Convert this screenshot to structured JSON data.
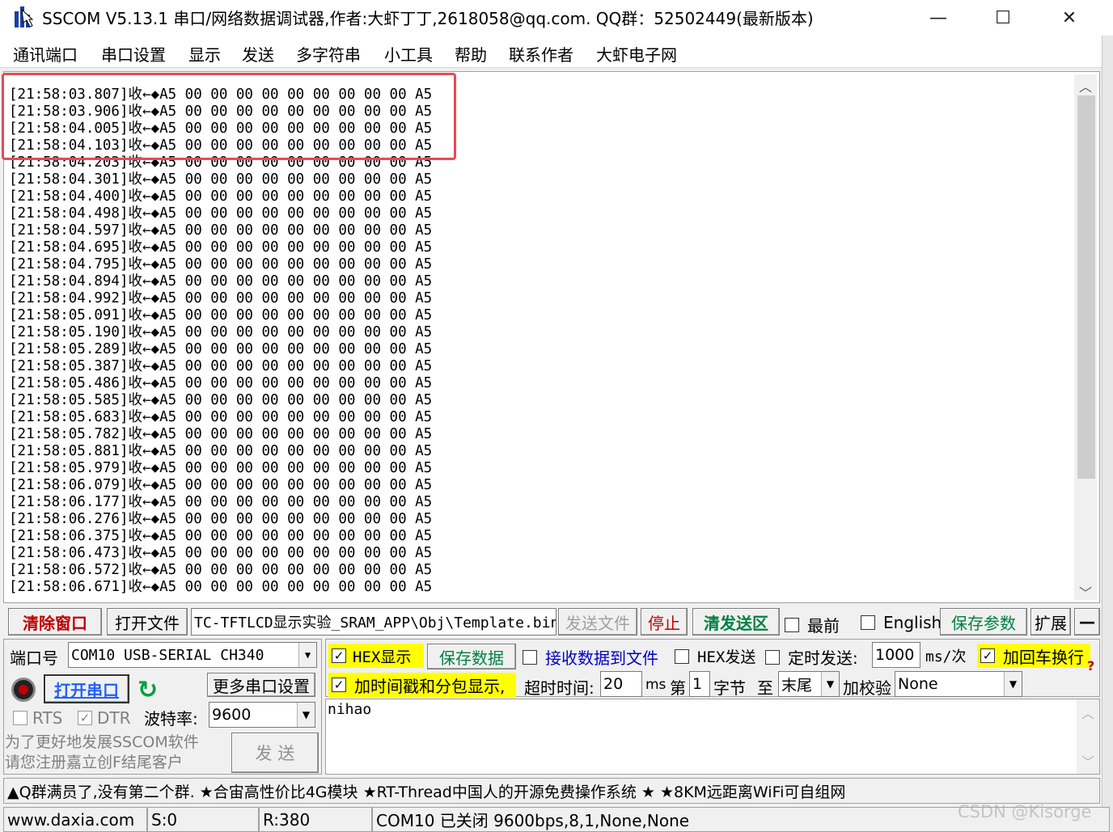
{
  "window": {
    "title": "SSCOM V5.13.1 串口/网络数据调试器,作者:大虾丁丁,2618058@qq.com. QQ群：52502449(最新版本)",
    "minimize": "—",
    "maximize": "☐",
    "close": "✕"
  },
  "menu": [
    "通讯端口",
    "串口设置",
    "显示",
    "发送",
    "多字符串",
    "小工具",
    "帮助",
    "联系作者",
    "大虾电子网"
  ],
  "log": {
    "direction": "收←◆",
    "payload": "A5 00 00 00 00 00 00 00 00 00 A5",
    "timestamps": [
      "21:58:03.807",
      "21:58:03.906",
      "21:58:04.005",
      "21:58:04.103",
      "21:58:04.203",
      "21:58:04.301",
      "21:58:04.400",
      "21:58:04.498",
      "21:58:04.597",
      "21:58:04.695",
      "21:58:04.795",
      "21:58:04.894",
      "21:58:04.992",
      "21:58:05.091",
      "21:58:05.190",
      "21:58:05.289",
      "21:58:05.387",
      "21:58:05.486",
      "21:58:05.585",
      "21:58:05.683",
      "21:58:05.782",
      "21:58:05.881",
      "21:58:05.979",
      "21:58:06.079",
      "21:58:06.177",
      "21:58:06.276",
      "21:58:06.375",
      "21:58:06.473",
      "21:58:06.572",
      "21:58:06.671"
    ]
  },
  "toolbar": {
    "clear_window": "清除窗口",
    "open_file": "打开文件",
    "file_path": "TC-TFTLCD显示实验_SRAM_APP\\Obj\\Template.bin",
    "send_file": "发送文件",
    "stop": "停止",
    "clear_send": "清发送区",
    "topmost": "最前",
    "english": "English",
    "save_params": "保存参数",
    "expand": "扩展",
    "collapse": "—"
  },
  "port": {
    "port_label": "端口号",
    "port_value": "COM10 USB-SERIAL CH340",
    "open_port": "打开串口",
    "more_settings": "更多串口设置",
    "rts": "RTS",
    "dtr": "DTR",
    "baud_label": "波特率:",
    "baud_value": "9600",
    "promo_line1": "为了更好地发展SSCOM软件",
    "promo_line2": "请您注册嘉立创F结尾客户",
    "send": "发  送"
  },
  "options": {
    "hex_display": "HEX显示",
    "save_data": "保存数据",
    "recv_to_file": "接收数据到文件",
    "hex_send": "HEX发送",
    "timed_send": "定时发送:",
    "interval": "1000",
    "interval_unit": "ms/次",
    "add_crlf": "加回车换行",
    "timestamp_split": "加时间戳和分包显示,",
    "timeout_label": "超时时间:",
    "timeout_value": "20",
    "timeout_unit": "ms",
    "byte_from_label": "第",
    "byte_from": "1",
    "byte_unit": "字节",
    "to_label": "至",
    "to_value": "末尾",
    "checksum_label": "加校验",
    "checksum_value": "None"
  },
  "send_text": "nihao",
  "marquee": "▲Q群满员了,没有第二个群. ★合宙高性价比4G模块 ★RT-Thread中国人的开源免费操作系统 ★ ★8KM远距离WiFi可自组网",
  "status": {
    "site": "www.daxia.com",
    "sent": "S:0",
    "received": "R:380",
    "port_state": "COM10 已关闭  9600bps,8,1,None,None"
  },
  "watermark": "CSDN @Kisorge",
  "colors": {
    "highlight": "#e64b55",
    "hex_bg": "#ffff00",
    "title_accent": "#c00000"
  }
}
